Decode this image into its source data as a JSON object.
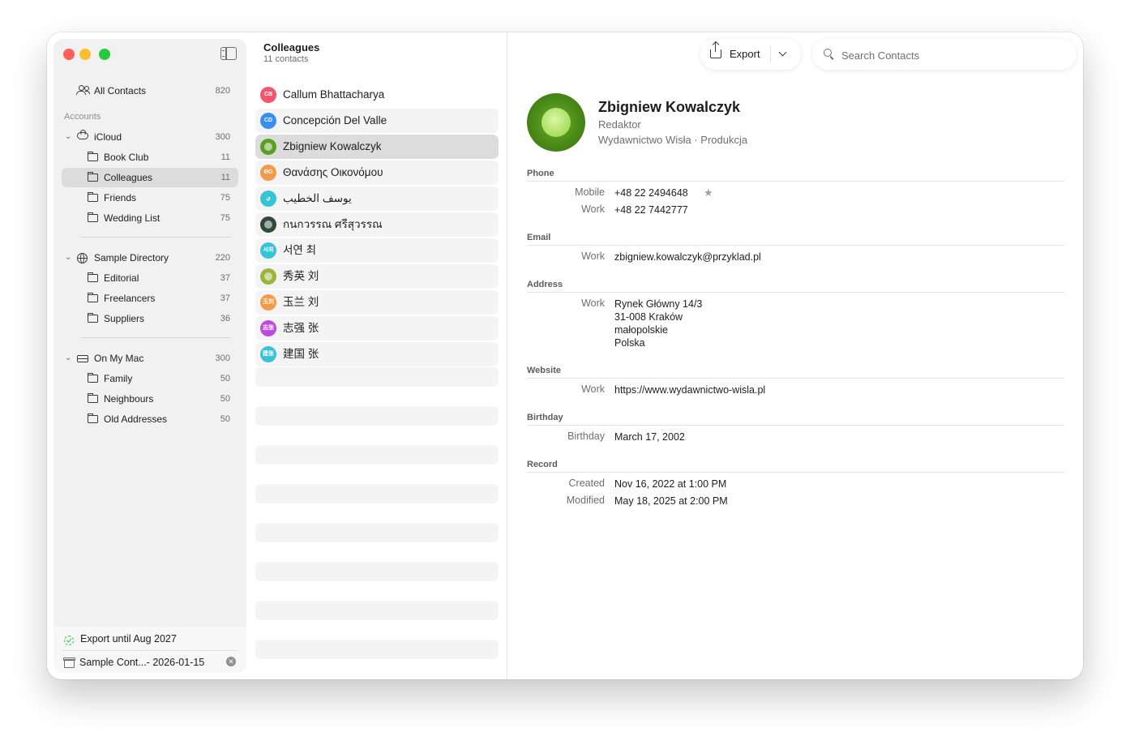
{
  "sidebar": {
    "all_contacts": {
      "label": "All Contacts",
      "count": "820"
    },
    "accounts_header": "Accounts",
    "icloud": {
      "label": "iCloud",
      "count": "300"
    },
    "icloud_groups": [
      {
        "label": "Book Club",
        "count": "11"
      },
      {
        "label": "Colleagues",
        "count": "11"
      },
      {
        "label": "Friends",
        "count": "75"
      },
      {
        "label": "Wedding List",
        "count": "75"
      }
    ],
    "sample_directory": {
      "label": "Sample Directory",
      "count": "220"
    },
    "directory_groups": [
      {
        "label": "Editorial",
        "count": "37"
      },
      {
        "label": "Freelancers",
        "count": "37"
      },
      {
        "label": "Suppliers",
        "count": "36"
      }
    ],
    "on_my_mac": {
      "label": "On My Mac",
      "count": "300"
    },
    "mac_groups": [
      {
        "label": "Family",
        "count": "50"
      },
      {
        "label": "Neighbours",
        "count": "50"
      },
      {
        "label": "Old Addresses",
        "count": "50"
      }
    ],
    "footer": {
      "export_status": "Export until Aug 2027",
      "archive_name": "Sample Cont...- 2026-01-15"
    }
  },
  "list": {
    "title": "Colleagues",
    "subtitle": "11 contacts",
    "contacts": [
      {
        "name": "Callum Bhattacharya",
        "initials": "CB",
        "color": "#f2566e"
      },
      {
        "name": "Concepción Del Valle",
        "initials": "CD",
        "color": "#3a8ef0"
      },
      {
        "name": "Zbigniew Kowalczyk",
        "initials": "",
        "color": "#5a9e22"
      },
      {
        "name": "Θανάσης Οικονόμου",
        "initials": "ΘΟ",
        "color": "#f39a4a"
      },
      {
        "name": "يوسف الخطيب",
        "initials": "ي",
        "color": "#36c3d6"
      },
      {
        "name": "กนกวรรณ ศรีสุวรรณ",
        "initials": "",
        "color": "#2f4a3a"
      },
      {
        "name": "서연 최",
        "initials": "서최",
        "color": "#36c3d6"
      },
      {
        "name": "秀英 刘",
        "initials": "",
        "color": "#9cb43a"
      },
      {
        "name": "玉兰 刘",
        "initials": "玉刘",
        "color": "#f39a4a"
      },
      {
        "name": "志强 张",
        "initials": "志张",
        "color": "#c04adf"
      },
      {
        "name": "建国 张",
        "initials": "建张",
        "color": "#36c3d6"
      }
    ]
  },
  "toolbar": {
    "export_label": "Export",
    "search_placeholder": "Search Contacts"
  },
  "detail": {
    "name": "Zbigniew Kowalczyk",
    "job_title": "Redaktor",
    "organization": "Wydawnictwo Wisła · Produkcja",
    "sections": {
      "phone": "Phone",
      "email": "Email",
      "address": "Address",
      "website": "Website",
      "birthday": "Birthday",
      "record": "Record"
    },
    "phone_mobile_label": "Mobile",
    "phone_mobile": "+48 22 2494648",
    "phone_work_label": "Work",
    "phone_work": "+48 22 7442777",
    "email_label": "Work",
    "email": "zbigniew.kowalczyk@przyklad.pl",
    "address_label": "Work",
    "address_lines": [
      "Rynek Główny 14/3",
      "31-008 Kraków",
      "małopolskie",
      "Polska"
    ],
    "website_label": "Work",
    "website": "https://www.wydawnictwo-wisla.pl",
    "birthday_label": "Birthday",
    "birthday": "March 17, 2002",
    "created_label": "Created",
    "created": "Nov 16, 2022 at 1:00 PM",
    "modified_label": "Modified",
    "modified": "May 18, 2025 at 2:00 PM"
  }
}
